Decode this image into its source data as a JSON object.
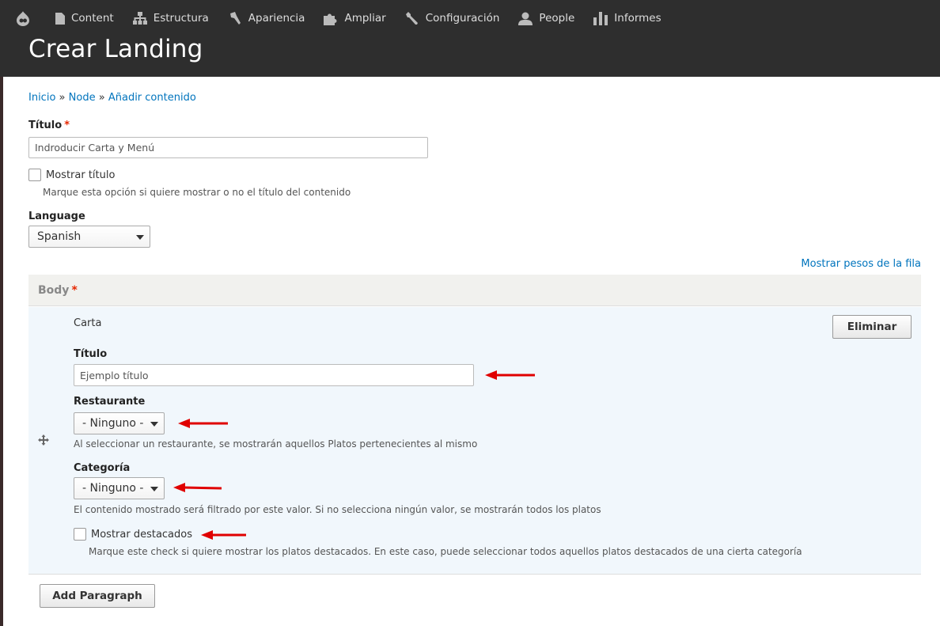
{
  "toolbar": {
    "items": [
      {
        "label": "Content",
        "icon": "content-icon"
      },
      {
        "label": "Estructura",
        "icon": "structure-icon"
      },
      {
        "label": "Apariencia",
        "icon": "appearance-icon"
      },
      {
        "label": "Ampliar",
        "icon": "extend-icon"
      },
      {
        "label": "Configuración",
        "icon": "wrench-icon"
      },
      {
        "label": "People",
        "icon": "people-icon"
      },
      {
        "label": "Informes",
        "icon": "reports-icon"
      }
    ]
  },
  "page": {
    "title": "Crear Landing"
  },
  "breadcrumb": {
    "items": [
      "Inicio",
      "Node",
      "Añadir contenido"
    ],
    "separator": "»"
  },
  "form": {
    "title_label": "Título",
    "title_value": "Indroducir Carta y Menú",
    "show_title_label": "Mostrar título",
    "show_title_desc": "Marque esta opción si quiere mostrar o no el título del contenido",
    "language_label": "Language",
    "language_value": "Spanish",
    "row_weights_link": "Mostrar pesos de la fila",
    "required_marker": "*"
  },
  "body": {
    "label": "Body",
    "paragraph_type": "Carta",
    "remove_button": "Eliminar",
    "titulo_label": "Título",
    "titulo_value": "Ejemplo título",
    "restaurante_label": "Restaurante",
    "restaurante_value": "- Ninguno -",
    "restaurante_desc": "Al seleccionar un restaurante, se mostrarán aquellos Platos pertenecientes al mismo",
    "categoria_label": "Categoría",
    "categoria_value": "- Ninguno -",
    "categoria_desc": "El contenido mostrado será filtrado por este valor. Si no selecciona ningún valor, se mostrarán todos los platos",
    "destacados_label": "Mostrar destacados",
    "destacados_desc": "Marque este check si quiere mostrar los platos destacados. En este caso, puede seleccionar todos aquellos platos destacados de una cierta categoría"
  },
  "add_paragraph_button": "Add Paragraph",
  "colors": {
    "toolbar_bg": "#2e2e2e",
    "link": "#0074bd",
    "required": "#e62600",
    "annotation_arrow": "#e00000"
  }
}
